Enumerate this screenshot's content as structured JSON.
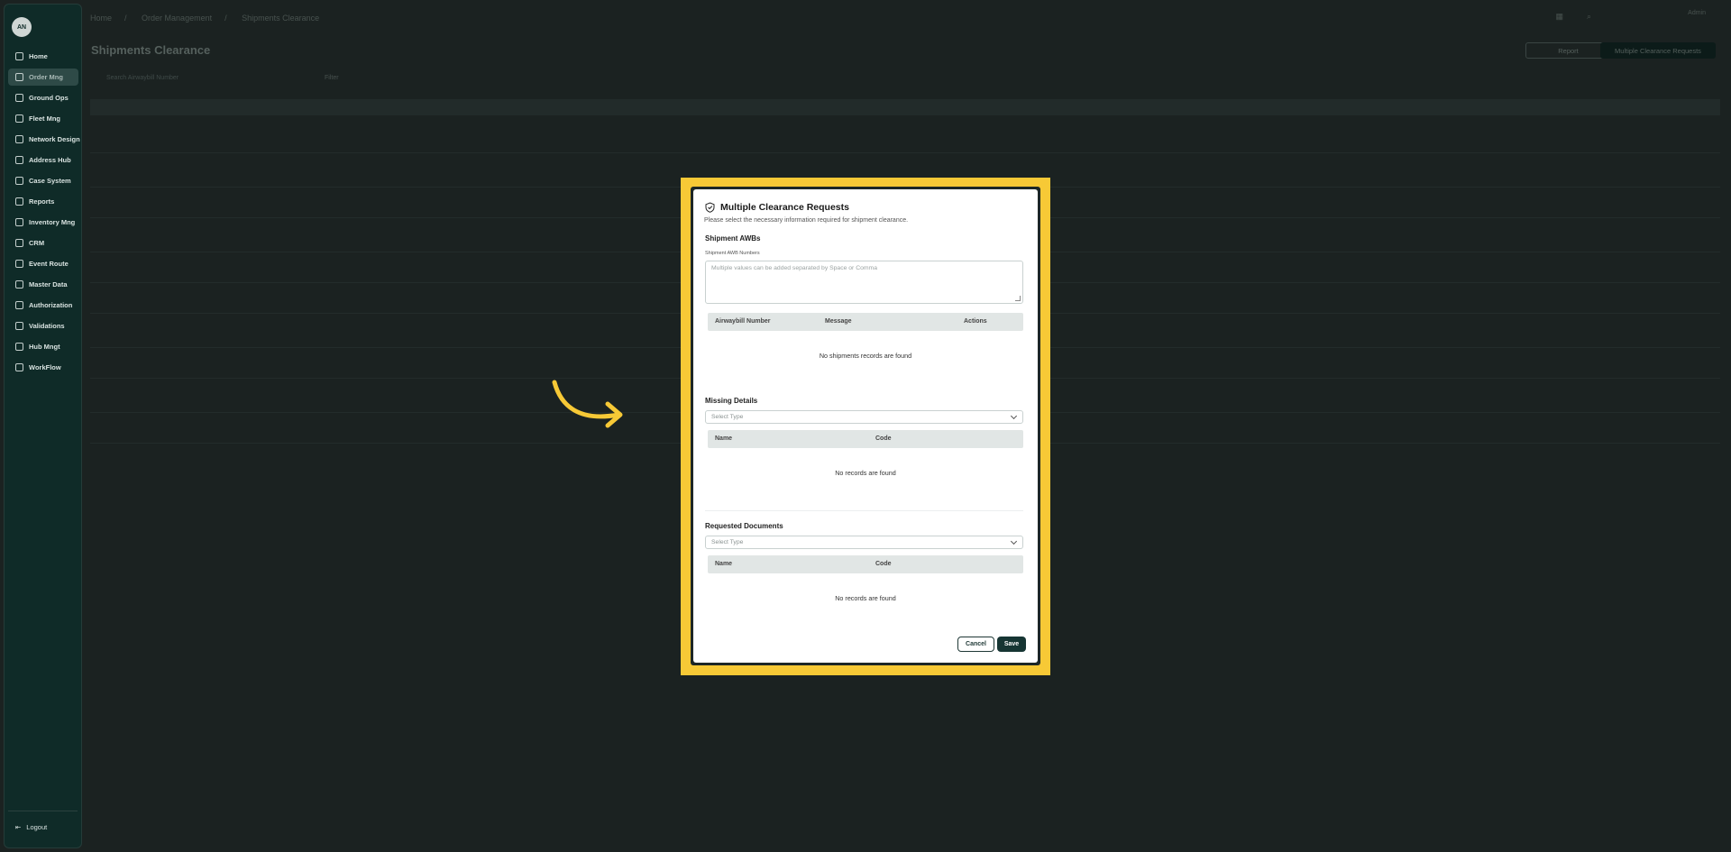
{
  "sidebar": {
    "logo": "AN",
    "items": [
      {
        "label": "Home"
      },
      {
        "label": "Order Mng"
      },
      {
        "label": "Ground Ops"
      },
      {
        "label": "Fleet Mng"
      },
      {
        "label": "Network Design"
      },
      {
        "label": "Address Hub"
      },
      {
        "label": "Case System"
      },
      {
        "label": "Reports"
      },
      {
        "label": "Inventory Mng"
      },
      {
        "label": "CRM"
      },
      {
        "label": "Event Route"
      },
      {
        "label": "Master Data"
      },
      {
        "label": "Authorization"
      },
      {
        "label": "Validations"
      },
      {
        "label": "Hub Mngt"
      },
      {
        "label": "WorkFlow"
      }
    ],
    "logout": "Logout"
  },
  "header": {
    "breadcrumb": [
      "Home",
      "Order Management",
      "Shipments Clearance"
    ],
    "user_name": "Admin"
  },
  "page": {
    "title": "Shipments Clearance",
    "report_button": "Report",
    "multi_button": "Multiple Clearance Requests",
    "search_placeholder": "Search Airwaybill Number",
    "filter_label": "Filter"
  },
  "modal": {
    "title": "Multiple Clearance Requests",
    "subtitle": "Please select the necessary information required for shipment clearance.",
    "awb_section": "Shipment AWBs",
    "awb_field_label": "Shipment AWB Numbers",
    "awb_placeholder": "Multiple values can be added separated by Space or Comma",
    "awb_table": {
      "col1": "Airwaybill Number",
      "col2": "Message",
      "col3": "Actions",
      "empty": "No shipments records are found"
    },
    "missing_section": "Missing Details",
    "missing_select": "Select Type",
    "missing_table": {
      "col1": "Name",
      "col2": "Code",
      "empty": "No records are found"
    },
    "docs_section": "Requested Documents",
    "docs_select": "Select Type",
    "docs_table": {
      "col1": "Name",
      "col2": "Code",
      "empty": "No records are found"
    },
    "cancel": "Cancel",
    "save": "Save"
  },
  "colors": {
    "highlight": "#f7c936",
    "primary": "#163533",
    "sidebar": "#0f2b28"
  }
}
